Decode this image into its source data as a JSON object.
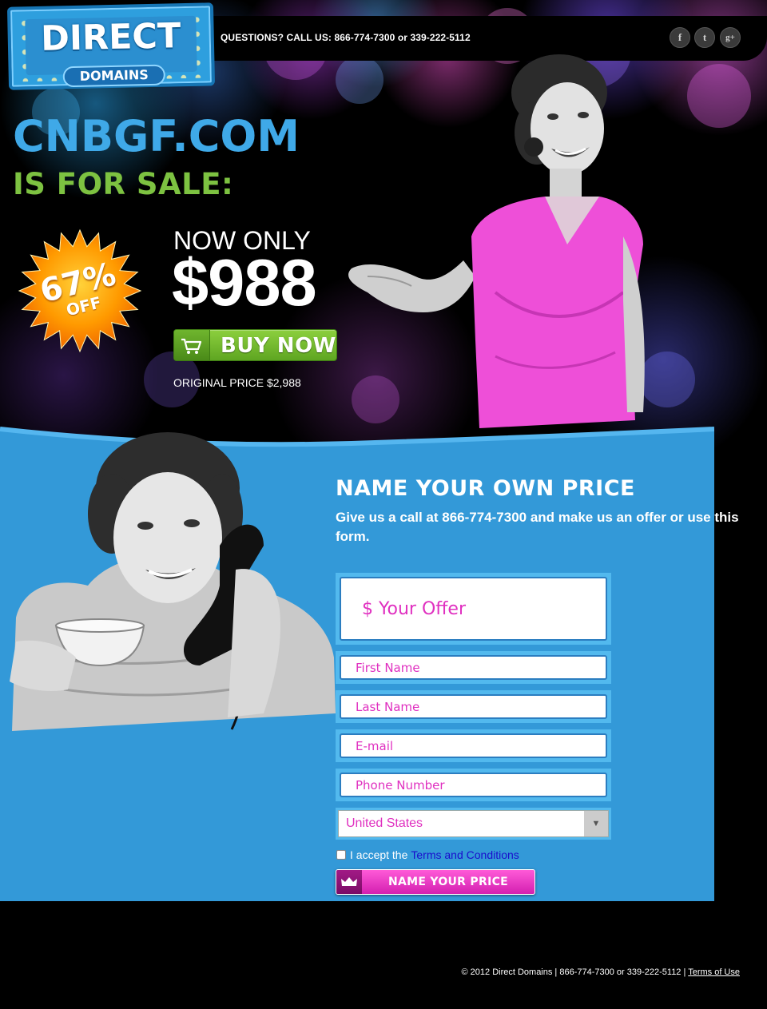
{
  "colors": {
    "accent_blue": "#3fa9e8",
    "accent_green": "#7dc241",
    "panel_blue": "#3399d8",
    "pink": "#e030c0",
    "burst_orange": "#ff8a00"
  },
  "logo": {
    "direct": "DIRECT",
    "domains": "DOMAINS"
  },
  "header": {
    "questions": "QUESTIONS? CALL US: 866-774-7300 or 339-222-5112",
    "social": [
      {
        "icon": "facebook-icon",
        "glyph": "f"
      },
      {
        "icon": "twitter-icon",
        "glyph": "t"
      },
      {
        "icon": "google-plus-icon",
        "glyph": "g+"
      }
    ]
  },
  "hero": {
    "domain": "CNBGF.COM",
    "for_sale": "IS FOR SALE:",
    "discount_pct": "67%",
    "discount_off": "OFF",
    "now_only": "NOW ONLY",
    "price": "$988",
    "buy_now": "BUY NOW",
    "original_price": "ORIGINAL PRICE $2,988"
  },
  "offer_form": {
    "title": "NAME YOUR OWN PRICE",
    "subtitle": "Give us a call at 866-774-7300 and make us an offer or use this form.",
    "offer_placeholder": "$ Your Offer",
    "first_name_placeholder": "First Name",
    "last_name_placeholder": "Last Name",
    "email_placeholder": "E-mail",
    "phone_placeholder": "Phone Number",
    "country_selected": "United States",
    "terms_prefix": "I accept the",
    "terms_link": "Terms and Conditions",
    "submit": "NAME YOUR PRICE"
  },
  "footer": {
    "text": "© 2012 Direct Domains | 866-774-7300 or 339-222-5112 |",
    "terms_link": "Terms of Use"
  }
}
